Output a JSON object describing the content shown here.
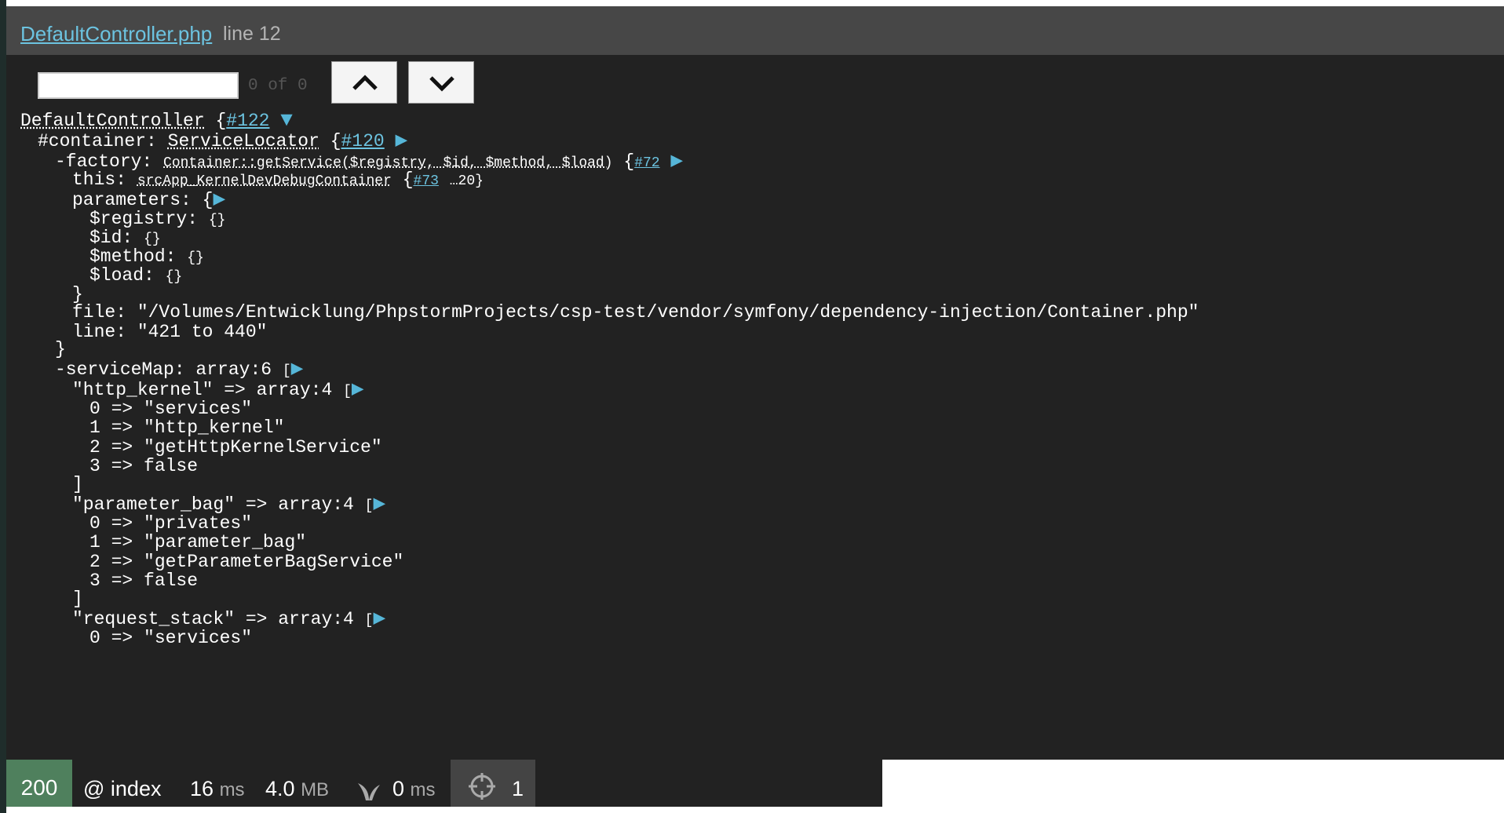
{
  "header": {
    "file_link": "DefaultController.php",
    "line_label": "line 12"
  },
  "search": {
    "placeholder": "",
    "value": "",
    "count_label": "0 of 0",
    "prev_icon": "chevron-up-icon",
    "next_icon": "chevron-down-icon"
  },
  "dump": {
    "l1": {
      "cls": "DefaultController",
      "brace": "{",
      "ref": "#122"
    },
    "l2": {
      "key": "#container: ",
      "cls": "ServiceLocator",
      "brace": "{",
      "ref": "#120"
    },
    "l3": {
      "key": "-factory: ",
      "cls": "Container::getService($registry, $id, $method, $load)",
      "brace": "{",
      "ref": "#72"
    },
    "l4": {
      "key": "this: ",
      "cls": "srcApp_KernelDevDebugContainer",
      "brace": "{",
      "ref": "#73",
      "tail": "…20}"
    },
    "l5": {
      "key": "parameters: {"
    },
    "l6": {
      "key": "$registry: ",
      "val": "{}"
    },
    "l7": {
      "key": "$id: ",
      "val": "{}"
    },
    "l8": {
      "key": "$method: ",
      "val": "{}"
    },
    "l9": {
      "key": "$load: ",
      "val": "{}"
    },
    "l10": {
      "text": "}"
    },
    "l11": {
      "text": "file: \"/Volumes/Entwicklung/PhpstormProjects/csp-test/vendor/symfony/dependency-injection/Container.php\""
    },
    "l12": {
      "text": "line: \"421 to 440\""
    },
    "l13": {
      "text": "}"
    },
    "l14": {
      "text": "-serviceMap: array:6 ",
      "open": "["
    },
    "l15": {
      "text": "\"http_kernel\" => array:4 ",
      "open": "["
    },
    "l16": {
      "text": "0 => \"services\""
    },
    "l17": {
      "text": "1 => \"http_kernel\""
    },
    "l18": {
      "text": "2 => \"getHttpKernelService\""
    },
    "l19": {
      "text": "3 => false"
    },
    "l20": {
      "text": "]"
    },
    "l21": {
      "text": "\"parameter_bag\" => array:4 ",
      "open": "["
    },
    "l22": {
      "text": "0 => \"privates\""
    },
    "l23": {
      "text": "1 => \"parameter_bag\""
    },
    "l24": {
      "text": "2 => \"getParameterBagService\""
    },
    "l25": {
      "text": "3 => false"
    },
    "l26": {
      "text": "]"
    },
    "l27": {
      "text": "\"request_stack\" => array:4 ",
      "open": "["
    },
    "l28": {
      "text": "0 => \"services\""
    }
  },
  "toolbar": {
    "status_code": "200",
    "route": "@ index",
    "time_value": "16",
    "time_unit": "ms",
    "memory_value": "4.0",
    "memory_unit": "MB",
    "twig_value": "0",
    "twig_unit": "ms",
    "dump_count": "1",
    "twig_icon": "sprout-icon",
    "dump_icon": "target-icon"
  },
  "colors": {
    "panel_bg": "#222222",
    "header_bg": "#474747",
    "link": "#6cc3e0",
    "toggle": "#56b6d8",
    "status_ok": "#4f805d"
  }
}
